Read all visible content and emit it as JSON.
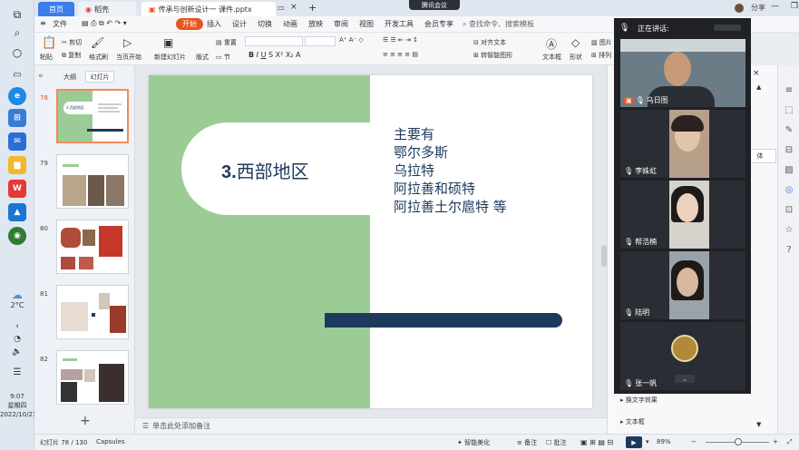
{
  "taskbar": {
    "weather_temp": "2°C",
    "time": "9:07",
    "weekday": "星期四",
    "date": "2022/10/27"
  },
  "titlebar": {
    "tab_home": "首页",
    "tab_docer": "稻壳",
    "tab_doc": "传承与创新设计一 课件.pptx",
    "meeting_badge": "腾讯会议",
    "share_label": "分享"
  },
  "menubar": {
    "file": "文件",
    "items": [
      "开始",
      "插入",
      "设计",
      "切换",
      "动画",
      "放映",
      "审阅",
      "视图",
      "开发工具",
      "会员专享"
    ],
    "search_placeholder": "查找命令、搜索模板"
  },
  "ribbon": {
    "paste": "粘贴",
    "cut": "剪切",
    "copy": "复制",
    "format_painter": "格式刷",
    "play_from_current": "当页开始",
    "new_slide": "新建幻灯片",
    "layout": "版式",
    "section": "节",
    "reset": "重置",
    "align_text": "对齐文本",
    "smart_shape": "转智能图形",
    "textbox": "文本框",
    "shape": "形状",
    "picture": "图片",
    "arrange": "排列"
  },
  "left_panel": {
    "tab_outline": "大纲",
    "tab_slides": "幻灯片",
    "slide_numbers": [
      "78",
      "79",
      "80",
      "81",
      "82"
    ],
    "thumb78_title": "3.西部地区"
  },
  "slide": {
    "title_num": "3.",
    "title_text": "西部地区",
    "list": [
      "主要有",
      "鄂尔多斯",
      "乌拉特",
      "阿拉善和硕特",
      "阿拉善土尔扈特  等"
    ]
  },
  "notes": {
    "placeholder": "单击此处添加备注"
  },
  "statusbar": {
    "slide_count": "幻灯片 78 / 130",
    "theme": "Capsules",
    "smart_beautify": "智能美化",
    "notes": "备注",
    "comments": "批注",
    "zoom": "89%"
  },
  "right_panel": {
    "text_effect": "换文字效果",
    "textbox": "文本框",
    "partial_label": "体"
  },
  "meeting": {
    "speaking_label": "正在讲话:",
    "participants": [
      "乌日图",
      "李姝虹",
      "帮浩楠",
      "陆明",
      "张一帆"
    ]
  }
}
